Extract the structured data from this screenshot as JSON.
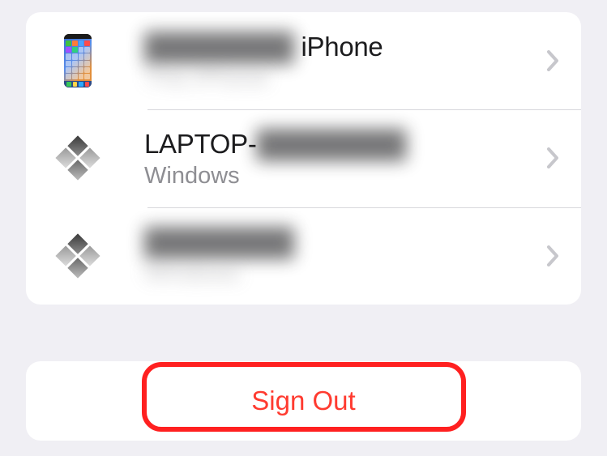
{
  "devices": [
    {
      "title_redacted": "████████",
      "title_suffix": " iPhone",
      "subtitle_redacted": "This iPhone",
      "icon": "iphone"
    },
    {
      "title_prefix": "LAPTOP-",
      "title_redacted": "████████",
      "subtitle": "Windows",
      "icon": "windows"
    },
    {
      "title_redacted": "████████",
      "subtitle_redacted": "Windows",
      "icon": "windows"
    }
  ],
  "signout": {
    "label": "Sign Out"
  }
}
